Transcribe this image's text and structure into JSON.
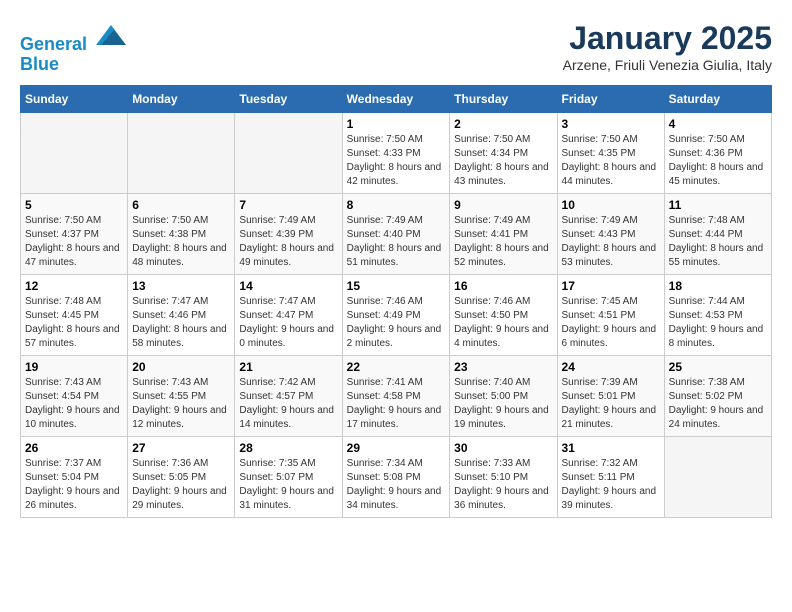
{
  "header": {
    "logo_line1": "General",
    "logo_line2": "Blue",
    "month": "January 2025",
    "location": "Arzene, Friuli Venezia Giulia, Italy"
  },
  "weekdays": [
    "Sunday",
    "Monday",
    "Tuesday",
    "Wednesday",
    "Thursday",
    "Friday",
    "Saturday"
  ],
  "weeks": [
    [
      {
        "day": "",
        "info": ""
      },
      {
        "day": "",
        "info": ""
      },
      {
        "day": "",
        "info": ""
      },
      {
        "day": "1",
        "info": "Sunrise: 7:50 AM\nSunset: 4:33 PM\nDaylight: 8 hours and 42 minutes."
      },
      {
        "day": "2",
        "info": "Sunrise: 7:50 AM\nSunset: 4:34 PM\nDaylight: 8 hours and 43 minutes."
      },
      {
        "day": "3",
        "info": "Sunrise: 7:50 AM\nSunset: 4:35 PM\nDaylight: 8 hours and 44 minutes."
      },
      {
        "day": "4",
        "info": "Sunrise: 7:50 AM\nSunset: 4:36 PM\nDaylight: 8 hours and 45 minutes."
      }
    ],
    [
      {
        "day": "5",
        "info": "Sunrise: 7:50 AM\nSunset: 4:37 PM\nDaylight: 8 hours and 47 minutes."
      },
      {
        "day": "6",
        "info": "Sunrise: 7:50 AM\nSunset: 4:38 PM\nDaylight: 8 hours and 48 minutes."
      },
      {
        "day": "7",
        "info": "Sunrise: 7:49 AM\nSunset: 4:39 PM\nDaylight: 8 hours and 49 minutes."
      },
      {
        "day": "8",
        "info": "Sunrise: 7:49 AM\nSunset: 4:40 PM\nDaylight: 8 hours and 51 minutes."
      },
      {
        "day": "9",
        "info": "Sunrise: 7:49 AM\nSunset: 4:41 PM\nDaylight: 8 hours and 52 minutes."
      },
      {
        "day": "10",
        "info": "Sunrise: 7:49 AM\nSunset: 4:43 PM\nDaylight: 8 hours and 53 minutes."
      },
      {
        "day": "11",
        "info": "Sunrise: 7:48 AM\nSunset: 4:44 PM\nDaylight: 8 hours and 55 minutes."
      }
    ],
    [
      {
        "day": "12",
        "info": "Sunrise: 7:48 AM\nSunset: 4:45 PM\nDaylight: 8 hours and 57 minutes."
      },
      {
        "day": "13",
        "info": "Sunrise: 7:47 AM\nSunset: 4:46 PM\nDaylight: 8 hours and 58 minutes."
      },
      {
        "day": "14",
        "info": "Sunrise: 7:47 AM\nSunset: 4:47 PM\nDaylight: 9 hours and 0 minutes."
      },
      {
        "day": "15",
        "info": "Sunrise: 7:46 AM\nSunset: 4:49 PM\nDaylight: 9 hours and 2 minutes."
      },
      {
        "day": "16",
        "info": "Sunrise: 7:46 AM\nSunset: 4:50 PM\nDaylight: 9 hours and 4 minutes."
      },
      {
        "day": "17",
        "info": "Sunrise: 7:45 AM\nSunset: 4:51 PM\nDaylight: 9 hours and 6 minutes."
      },
      {
        "day": "18",
        "info": "Sunrise: 7:44 AM\nSunset: 4:53 PM\nDaylight: 9 hours and 8 minutes."
      }
    ],
    [
      {
        "day": "19",
        "info": "Sunrise: 7:43 AM\nSunset: 4:54 PM\nDaylight: 9 hours and 10 minutes."
      },
      {
        "day": "20",
        "info": "Sunrise: 7:43 AM\nSunset: 4:55 PM\nDaylight: 9 hours and 12 minutes."
      },
      {
        "day": "21",
        "info": "Sunrise: 7:42 AM\nSunset: 4:57 PM\nDaylight: 9 hours and 14 minutes."
      },
      {
        "day": "22",
        "info": "Sunrise: 7:41 AM\nSunset: 4:58 PM\nDaylight: 9 hours and 17 minutes."
      },
      {
        "day": "23",
        "info": "Sunrise: 7:40 AM\nSunset: 5:00 PM\nDaylight: 9 hours and 19 minutes."
      },
      {
        "day": "24",
        "info": "Sunrise: 7:39 AM\nSunset: 5:01 PM\nDaylight: 9 hours and 21 minutes."
      },
      {
        "day": "25",
        "info": "Sunrise: 7:38 AM\nSunset: 5:02 PM\nDaylight: 9 hours and 24 minutes."
      }
    ],
    [
      {
        "day": "26",
        "info": "Sunrise: 7:37 AM\nSunset: 5:04 PM\nDaylight: 9 hours and 26 minutes."
      },
      {
        "day": "27",
        "info": "Sunrise: 7:36 AM\nSunset: 5:05 PM\nDaylight: 9 hours and 29 minutes."
      },
      {
        "day": "28",
        "info": "Sunrise: 7:35 AM\nSunset: 5:07 PM\nDaylight: 9 hours and 31 minutes."
      },
      {
        "day": "29",
        "info": "Sunrise: 7:34 AM\nSunset: 5:08 PM\nDaylight: 9 hours and 34 minutes."
      },
      {
        "day": "30",
        "info": "Sunrise: 7:33 AM\nSunset: 5:10 PM\nDaylight: 9 hours and 36 minutes."
      },
      {
        "day": "31",
        "info": "Sunrise: 7:32 AM\nSunset: 5:11 PM\nDaylight: 9 hours and 39 minutes."
      },
      {
        "day": "",
        "info": ""
      }
    ]
  ]
}
